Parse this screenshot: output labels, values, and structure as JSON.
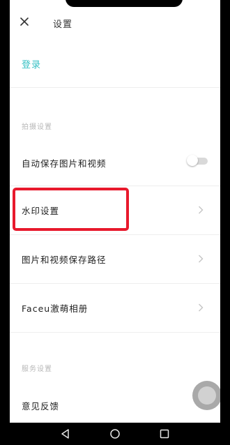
{
  "header": {
    "close_icon": "close-icon",
    "title": "设置"
  },
  "account": {
    "login_label": "登录",
    "accent_color": "#36c0c4"
  },
  "sections": {
    "shooting": {
      "label": "拍摄设置",
      "items": [
        {
          "label": "自动保存图片和视频",
          "control": "toggle",
          "toggle_on": false
        },
        {
          "label": "水印设置",
          "control": "chevron",
          "highlighted": true
        },
        {
          "label": "图片和视频保存路径",
          "control": "chevron"
        },
        {
          "label": "Faceu激萌相册",
          "control": "chevron"
        }
      ]
    },
    "service": {
      "label": "服务设置",
      "items": [
        {
          "label": "意见反馈"
        }
      ]
    }
  },
  "annotation": {
    "highlight_color": "#e8192c"
  },
  "navbar": {
    "icons": [
      "back-icon",
      "home-icon",
      "recent-apps-icon"
    ]
  }
}
